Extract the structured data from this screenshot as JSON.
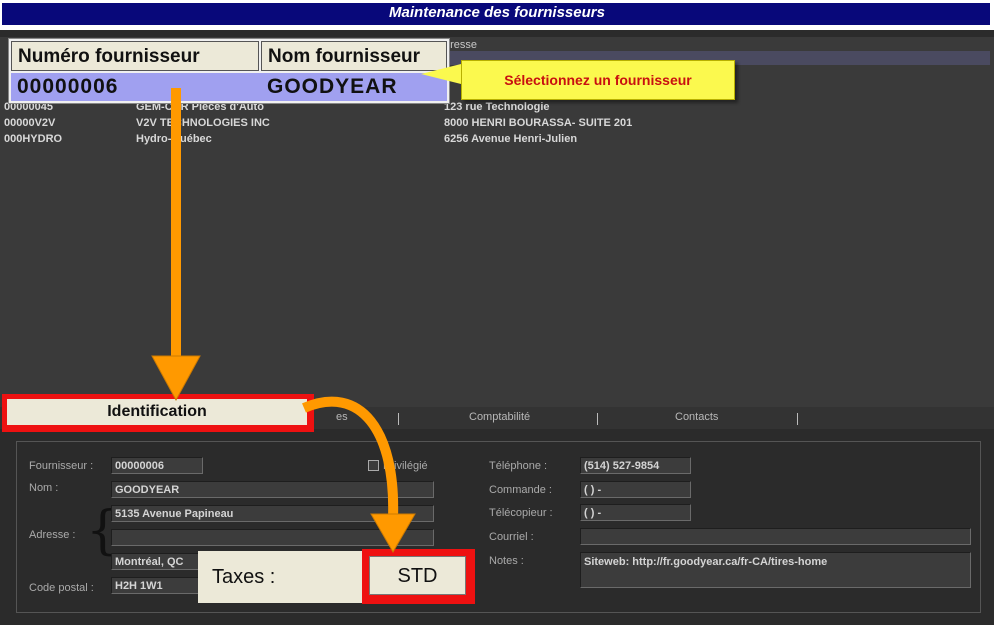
{
  "window": {
    "title": "Maintenance des fournisseurs"
  },
  "grid": {
    "col_adresse": "dresse",
    "rows": [
      {
        "num": "00000045",
        "nom": "GEM-CAR Pièces d'Auto",
        "adresse": "123 rue Technologie"
      },
      {
        "num": "00000V2V",
        "nom": "V2V TECHNOLOGIES INC",
        "adresse": "8000 HENRI BOURASSA- SUITE 201"
      },
      {
        "num": "000HYDRO",
        "nom": "Hydro-Québec",
        "adresse": "6256 Avenue Henri-Julien"
      }
    ]
  },
  "zoom": {
    "col_num": "Numéro fournisseur",
    "col_nom": "Nom fournisseur",
    "sel_num": "00000006",
    "sel_nom": "GOODYEAR"
  },
  "callout": {
    "text": "Sélectionnez un fournisseur"
  },
  "tabs": {
    "identification": "Identification",
    "partial": "es",
    "comptabilite": "Comptabilité",
    "contacts": "Contacts"
  },
  "form": {
    "fournisseur_label": "Fournisseur :",
    "fournisseur_value": "00000006",
    "privilegie_label": "Privilégié",
    "nom_label": "Nom :",
    "nom_value": "GOODYEAR",
    "adresse_label": "Adresse :",
    "adresse_line1": "5135 Avenue Papineau",
    "adresse_line2": "",
    "adresse_line3": "Montréal, QC",
    "code_postal_label": "Code postal :",
    "code_postal_value": "H2H 1W1",
    "telephone_label": "Téléphone :",
    "telephone_value": "(514) 527-9854",
    "commande_label": "Commande :",
    "commande_value": "(   )    -",
    "telecopieur_label": "Télécopieur :",
    "telecopieur_value": "(   )    -",
    "courriel_label": "Courriel :",
    "courriel_value": "",
    "notes_label": "Notes :",
    "notes_value": "Siteweb: http://fr.goodyear.ca/fr-CA/tires-home"
  },
  "taxes": {
    "label": "Taxes :",
    "value": "STD"
  },
  "colors": {
    "title_bar": "#08087a",
    "highlight_red": "#ee1111",
    "callout_yellow": "#fbf94e",
    "arrow_orange": "#ff9900"
  }
}
